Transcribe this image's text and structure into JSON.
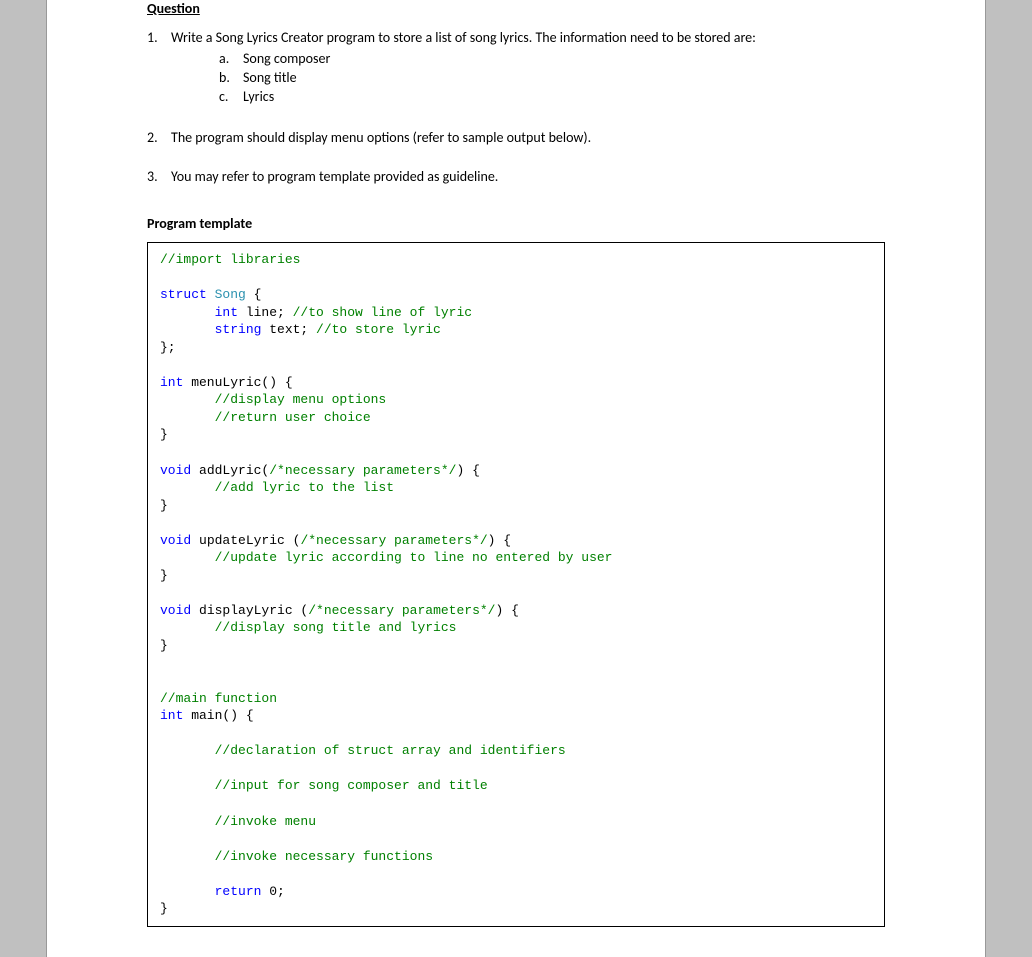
{
  "heading": "Question",
  "q1": {
    "num": "1.",
    "text": "Write a Song Lyrics Creator program to store a list of song lyrics. The information need to be stored are:",
    "a": {
      "marker": "a.",
      "text": "Song composer"
    },
    "b": {
      "marker": "b.",
      "text": "Song title"
    },
    "c": {
      "marker": "c.",
      "text": "Lyrics"
    }
  },
  "q2": {
    "num": "2.",
    "text": "The program should display menu options (refer to sample output below)."
  },
  "q3": {
    "num": "3.",
    "text": "You may refer to program template provided as guideline."
  },
  "program_template_heading": "Program template",
  "code": {
    "l1": "//import libraries",
    "l2": "struct",
    "l2b": " Song",
    "l2c": " {",
    "l3a": "       int",
    "l3b": " line; ",
    "l3c": "//to show line of lyric",
    "l4a": "       string",
    "l4b": " text; ",
    "l4c": "//to store lyric",
    "l5": "};",
    "l6a": "int",
    "l6b": " menuLyric() {",
    "l7": "       //display menu options",
    "l8": "       //return user choice",
    "l9": "}",
    "l10a": "void",
    "l10b": " addLyric(",
    "l10c": "/*necessary parameters*/",
    "l10d": ") {",
    "l11": "       //add lyric to the list",
    "l12": "}",
    "l13a": "void",
    "l13b": " updateLyric (",
    "l13c": "/*necessary parameters*/",
    "l13d": ") {",
    "l14": "       //update lyric according to line no entered by user",
    "l15": "}",
    "l16a": "void",
    "l16b": " displayLyric (",
    "l16c": "/*necessary parameters*/",
    "l16d": ") {",
    "l17": "       //display song title and lyrics",
    "l18": "}",
    "l19": "//main function",
    "l20a": "int",
    "l20b": " main() {",
    "l21": "       //declaration of struct array and identifiers",
    "l22": "       //input for song composer and title",
    "l23": "       //invoke menu",
    "l24": "       //invoke necessary functions",
    "l25a": "       return",
    "l25b": " 0;",
    "l26": "}",
    "blank": ""
  }
}
